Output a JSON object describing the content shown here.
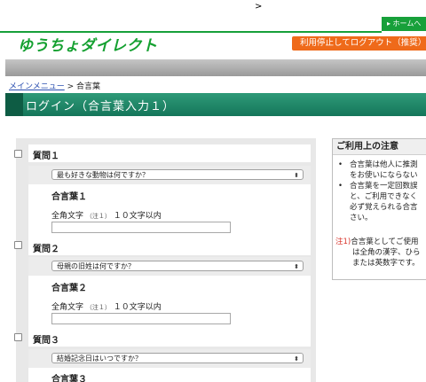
{
  "top": {
    "mark": ">"
  },
  "header": {
    "home_link": "▸ ホームへ",
    "logo": "ゆうちょダイレクト",
    "logout_button": "利用停止してログアウト（推奨）"
  },
  "breadcrumb": {
    "menu": "メインメニュー",
    "separator": ">",
    "current": "合言葉"
  },
  "page_title": "ログイン（合言葉入力１）",
  "questions": [
    {
      "label": "質問１",
      "selected": "最も好きな動物は何ですか？",
      "pass_title": "合言葉１",
      "hint": "全角文字",
      "hint_note": "（注１）",
      "hint_len": "１０文字以内",
      "value": ""
    },
    {
      "label": "質問２",
      "selected": "母親の旧姓は何ですか？",
      "pass_title": "合言葉２",
      "hint": "全角文字",
      "hint_note": "（注１）",
      "hint_len": "１０文字以内",
      "value": ""
    },
    {
      "label": "質問３",
      "selected": "結婚記念日はいつですか？",
      "pass_title": "合言葉３"
    }
  ],
  "notice": {
    "title": "ご利用上の注意",
    "items": [
      [
        "合言葉は他人に推測",
        "をお使いにならない"
      ],
      [
        "合言葉を一定回数誤",
        "と、ご利用できなく",
        "必ず覚えられる合言",
        "さい。"
      ]
    ],
    "note_marker": "注1)",
    "note_lines": [
      "合言葉としてご使用",
      "は全角の漢字、ひら",
      "または英数字です。"
    ]
  },
  "colors": {
    "brand_green": "#17a03a",
    "title_green": "#15765a",
    "logout_orange": "#ef6a1a",
    "link_blue": "#2a4fb0",
    "note_red": "#d9342b"
  }
}
